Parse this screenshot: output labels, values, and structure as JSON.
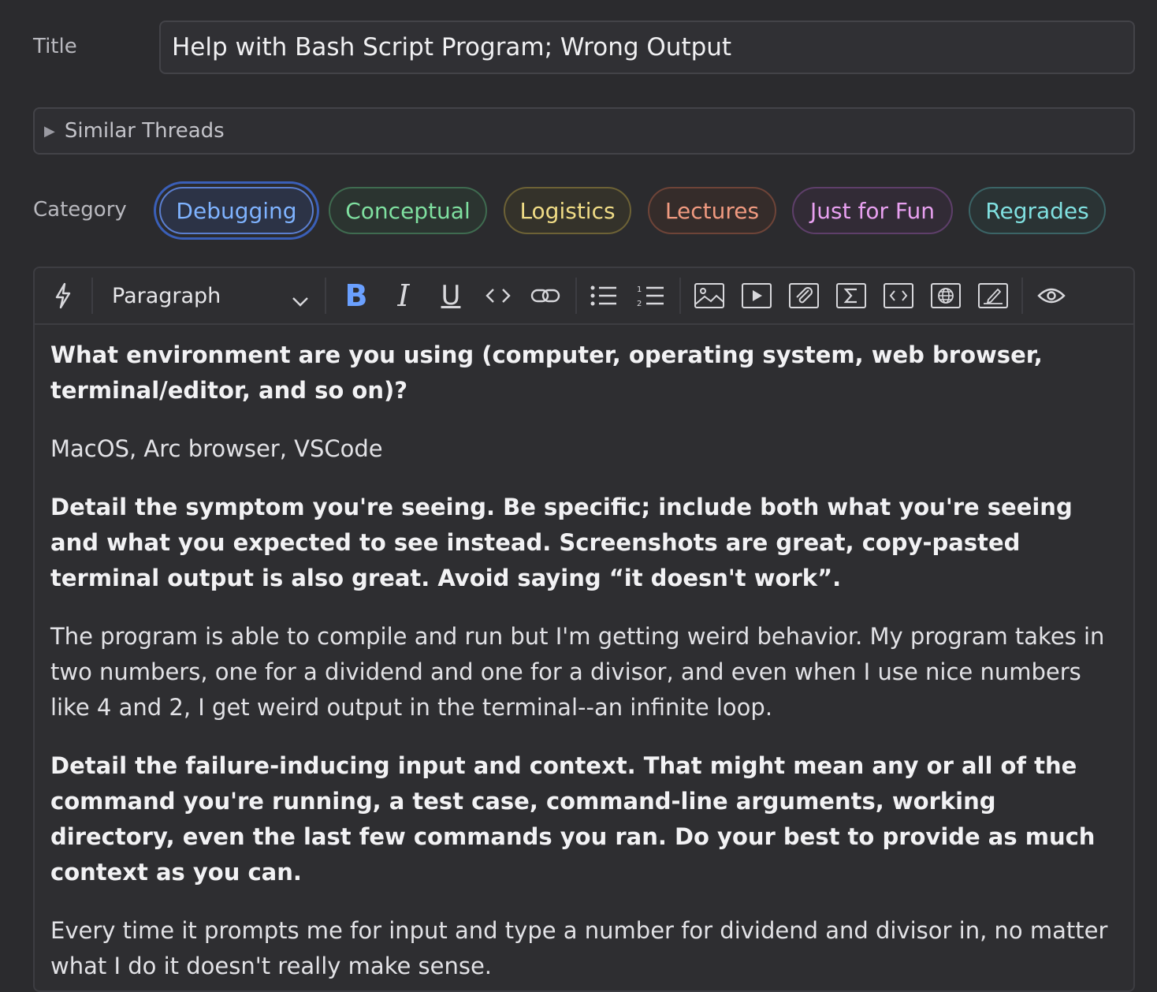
{
  "title_field": {
    "label": "Title",
    "value": "Help with Bash Script Program; Wrong Output"
  },
  "similar_threads": {
    "label": "Similar Threads",
    "icon": "triangle-right-icon"
  },
  "category": {
    "label": "Category",
    "selected": "Debugging",
    "options": [
      {
        "label": "Debugging",
        "color": "#7fb3ff",
        "border": "#5b7fd0",
        "bg": "#2c3346"
      },
      {
        "label": "Conceptual",
        "color": "#7fe0a0",
        "border": "#3f6b50",
        "bg": "#2b3430"
      },
      {
        "label": "Logistics",
        "color": "#f0dc86",
        "border": "#6d6236",
        "bg": "#34322a"
      },
      {
        "label": "Lectures",
        "color": "#f09a80",
        "border": "#6e4438",
        "bg": "#352c2a"
      },
      {
        "label": "Just for Fun",
        "color": "#e8a0f0",
        "border": "#5e3f6a",
        "bg": "#322b36"
      },
      {
        "label": "Regrades",
        "color": "#80e0e0",
        "border": "#3b6466",
        "bg": "#2a3334"
      }
    ]
  },
  "toolbar": {
    "format_select": "Paragraph",
    "buttons": [
      "lightning-icon",
      "bold-icon",
      "italic-icon",
      "underline-icon",
      "inline-code-icon",
      "link-icon",
      "bullet-list-icon",
      "numbered-list-icon",
      "image-icon",
      "video-icon",
      "attachment-icon",
      "math-icon",
      "code-block-icon",
      "web-embed-icon",
      "drawing-icon",
      "preview-icon"
    ],
    "accent": "#6aa0ff"
  },
  "body": {
    "q1": "What environment are you using (computer, operating system, web browser, terminal/editor, and so on)?",
    "a1": "MacOS, Arc browser, VSCode",
    "q2": "Detail the symptom you're seeing. Be specific; include both what you're seeing and what you expected to see instead. Screenshots are great, copy-pasted terminal output is also great. Avoid saying “it doesn't work”.",
    "a2": "The program is able to compile and run but I'm getting weird behavior. My program takes in two numbers, one for a dividend and one for a divisor, and even when I use nice numbers like 4 and 2, I get weird output in the terminal--an infinite loop.",
    "q3": "Detail the failure-inducing input and context. That might mean any or all of the command you're running, a test case, command-line arguments, working directory, even the last few commands you ran. Do your best to provide as much context as you can.",
    "a3": "Every time it prompts me for input and type a number for dividend and divisor in, no matter what I do it doesn't really make sense."
  }
}
